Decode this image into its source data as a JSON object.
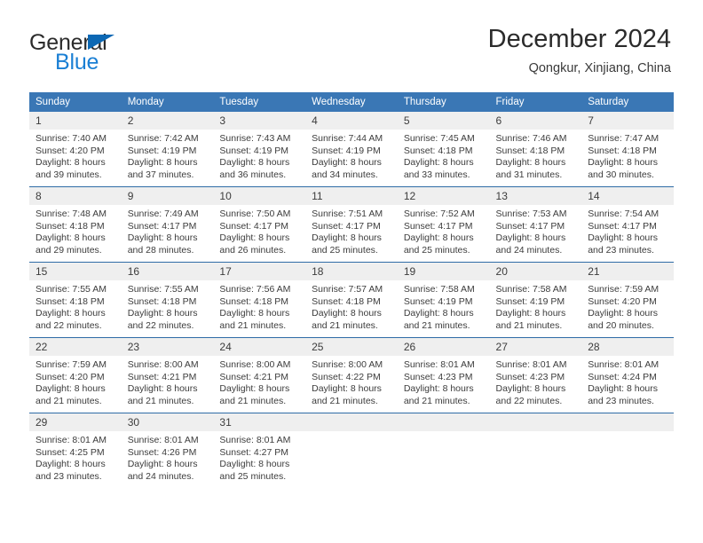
{
  "brand": {
    "word1": "General",
    "word2": "Blue",
    "triangle_color": "#0c68b4",
    "blue_color": "#1a7fd4"
  },
  "header": {
    "title": "December 2024",
    "subtitle": "Qongkur, Xinjiang, China"
  },
  "calendar": {
    "header_color": "#3a77b5",
    "daynum_band_color": "#efefef",
    "weekday_headers": [
      "Sunday",
      "Monday",
      "Tuesday",
      "Wednesday",
      "Thursday",
      "Friday",
      "Saturday"
    ],
    "weeks": [
      [
        {
          "day": "1",
          "sunrise": "Sunrise: 7:40 AM",
          "sunset": "Sunset: 4:20 PM",
          "daylight1": "Daylight: 8 hours",
          "daylight2": "and 39 minutes."
        },
        {
          "day": "2",
          "sunrise": "Sunrise: 7:42 AM",
          "sunset": "Sunset: 4:19 PM",
          "daylight1": "Daylight: 8 hours",
          "daylight2": "and 37 minutes."
        },
        {
          "day": "3",
          "sunrise": "Sunrise: 7:43 AM",
          "sunset": "Sunset: 4:19 PM",
          "daylight1": "Daylight: 8 hours",
          "daylight2": "and 36 minutes."
        },
        {
          "day": "4",
          "sunrise": "Sunrise: 7:44 AM",
          "sunset": "Sunset: 4:19 PM",
          "daylight1": "Daylight: 8 hours",
          "daylight2": "and 34 minutes."
        },
        {
          "day": "5",
          "sunrise": "Sunrise: 7:45 AM",
          "sunset": "Sunset: 4:18 PM",
          "daylight1": "Daylight: 8 hours",
          "daylight2": "and 33 minutes."
        },
        {
          "day": "6",
          "sunrise": "Sunrise: 7:46 AM",
          "sunset": "Sunset: 4:18 PM",
          "daylight1": "Daylight: 8 hours",
          "daylight2": "and 31 minutes."
        },
        {
          "day": "7",
          "sunrise": "Sunrise: 7:47 AM",
          "sunset": "Sunset: 4:18 PM",
          "daylight1": "Daylight: 8 hours",
          "daylight2": "and 30 minutes."
        }
      ],
      [
        {
          "day": "8",
          "sunrise": "Sunrise: 7:48 AM",
          "sunset": "Sunset: 4:18 PM",
          "daylight1": "Daylight: 8 hours",
          "daylight2": "and 29 minutes."
        },
        {
          "day": "9",
          "sunrise": "Sunrise: 7:49 AM",
          "sunset": "Sunset: 4:17 PM",
          "daylight1": "Daylight: 8 hours",
          "daylight2": "and 28 minutes."
        },
        {
          "day": "10",
          "sunrise": "Sunrise: 7:50 AM",
          "sunset": "Sunset: 4:17 PM",
          "daylight1": "Daylight: 8 hours",
          "daylight2": "and 26 minutes."
        },
        {
          "day": "11",
          "sunrise": "Sunrise: 7:51 AM",
          "sunset": "Sunset: 4:17 PM",
          "daylight1": "Daylight: 8 hours",
          "daylight2": "and 25 minutes."
        },
        {
          "day": "12",
          "sunrise": "Sunrise: 7:52 AM",
          "sunset": "Sunset: 4:17 PM",
          "daylight1": "Daylight: 8 hours",
          "daylight2": "and 25 minutes."
        },
        {
          "day": "13",
          "sunrise": "Sunrise: 7:53 AM",
          "sunset": "Sunset: 4:17 PM",
          "daylight1": "Daylight: 8 hours",
          "daylight2": "and 24 minutes."
        },
        {
          "day": "14",
          "sunrise": "Sunrise: 7:54 AM",
          "sunset": "Sunset: 4:17 PM",
          "daylight1": "Daylight: 8 hours",
          "daylight2": "and 23 minutes."
        }
      ],
      [
        {
          "day": "15",
          "sunrise": "Sunrise: 7:55 AM",
          "sunset": "Sunset: 4:18 PM",
          "daylight1": "Daylight: 8 hours",
          "daylight2": "and 22 minutes."
        },
        {
          "day": "16",
          "sunrise": "Sunrise: 7:55 AM",
          "sunset": "Sunset: 4:18 PM",
          "daylight1": "Daylight: 8 hours",
          "daylight2": "and 22 minutes."
        },
        {
          "day": "17",
          "sunrise": "Sunrise: 7:56 AM",
          "sunset": "Sunset: 4:18 PM",
          "daylight1": "Daylight: 8 hours",
          "daylight2": "and 21 minutes."
        },
        {
          "day": "18",
          "sunrise": "Sunrise: 7:57 AM",
          "sunset": "Sunset: 4:18 PM",
          "daylight1": "Daylight: 8 hours",
          "daylight2": "and 21 minutes."
        },
        {
          "day": "19",
          "sunrise": "Sunrise: 7:58 AM",
          "sunset": "Sunset: 4:19 PM",
          "daylight1": "Daylight: 8 hours",
          "daylight2": "and 21 minutes."
        },
        {
          "day": "20",
          "sunrise": "Sunrise: 7:58 AM",
          "sunset": "Sunset: 4:19 PM",
          "daylight1": "Daylight: 8 hours",
          "daylight2": "and 21 minutes."
        },
        {
          "day": "21",
          "sunrise": "Sunrise: 7:59 AM",
          "sunset": "Sunset: 4:20 PM",
          "daylight1": "Daylight: 8 hours",
          "daylight2": "and 20 minutes."
        }
      ],
      [
        {
          "day": "22",
          "sunrise": "Sunrise: 7:59 AM",
          "sunset": "Sunset: 4:20 PM",
          "daylight1": "Daylight: 8 hours",
          "daylight2": "and 21 minutes."
        },
        {
          "day": "23",
          "sunrise": "Sunrise: 8:00 AM",
          "sunset": "Sunset: 4:21 PM",
          "daylight1": "Daylight: 8 hours",
          "daylight2": "and 21 minutes."
        },
        {
          "day": "24",
          "sunrise": "Sunrise: 8:00 AM",
          "sunset": "Sunset: 4:21 PM",
          "daylight1": "Daylight: 8 hours",
          "daylight2": "and 21 minutes."
        },
        {
          "day": "25",
          "sunrise": "Sunrise: 8:00 AM",
          "sunset": "Sunset: 4:22 PM",
          "daylight1": "Daylight: 8 hours",
          "daylight2": "and 21 minutes."
        },
        {
          "day": "26",
          "sunrise": "Sunrise: 8:01 AM",
          "sunset": "Sunset: 4:23 PM",
          "daylight1": "Daylight: 8 hours",
          "daylight2": "and 21 minutes."
        },
        {
          "day": "27",
          "sunrise": "Sunrise: 8:01 AM",
          "sunset": "Sunset: 4:23 PM",
          "daylight1": "Daylight: 8 hours",
          "daylight2": "and 22 minutes."
        },
        {
          "day": "28",
          "sunrise": "Sunrise: 8:01 AM",
          "sunset": "Sunset: 4:24 PM",
          "daylight1": "Daylight: 8 hours",
          "daylight2": "and 23 minutes."
        }
      ],
      [
        {
          "day": "29",
          "sunrise": "Sunrise: 8:01 AM",
          "sunset": "Sunset: 4:25 PM",
          "daylight1": "Daylight: 8 hours",
          "daylight2": "and 23 minutes."
        },
        {
          "day": "30",
          "sunrise": "Sunrise: 8:01 AM",
          "sunset": "Sunset: 4:26 PM",
          "daylight1": "Daylight: 8 hours",
          "daylight2": "and 24 minutes."
        },
        {
          "day": "31",
          "sunrise": "Sunrise: 8:01 AM",
          "sunset": "Sunset: 4:27 PM",
          "daylight1": "Daylight: 8 hours",
          "daylight2": "and 25 minutes."
        },
        {
          "day": "",
          "sunrise": "",
          "sunset": "",
          "daylight1": "",
          "daylight2": ""
        },
        {
          "day": "",
          "sunrise": "",
          "sunset": "",
          "daylight1": "",
          "daylight2": ""
        },
        {
          "day": "",
          "sunrise": "",
          "sunset": "",
          "daylight1": "",
          "daylight2": ""
        },
        {
          "day": "",
          "sunrise": "",
          "sunset": "",
          "daylight1": "",
          "daylight2": ""
        }
      ]
    ]
  }
}
